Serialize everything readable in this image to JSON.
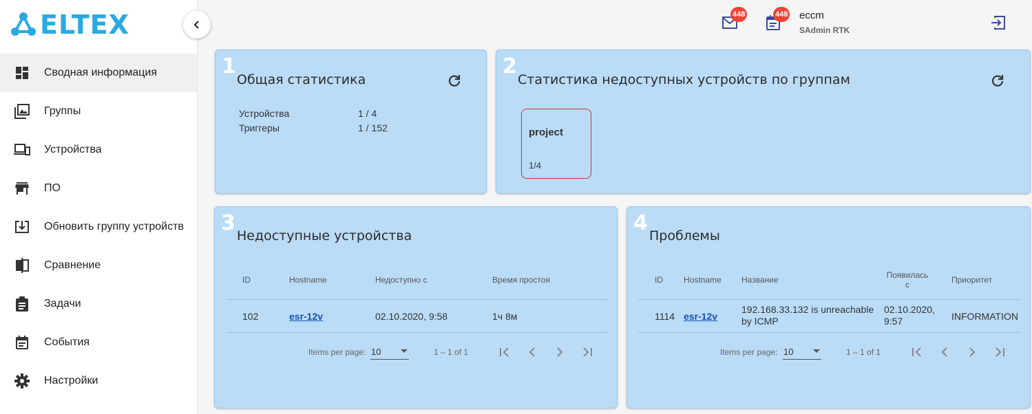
{
  "brand": {
    "logo_text": "ELTEX",
    "color": "#29a9e1"
  },
  "sidebar": {
    "items": [
      {
        "label": "Сводная информация",
        "icon": "dashboard-icon",
        "active": true
      },
      {
        "label": "Группы",
        "icon": "image-library-icon"
      },
      {
        "label": "Устройства",
        "icon": "devices-icon"
      },
      {
        "label": "ПО",
        "icon": "store-icon"
      },
      {
        "label": "Обновить группу устройств",
        "icon": "download-box-icon"
      },
      {
        "label": "Сравнение",
        "icon": "compare-icon"
      },
      {
        "label": "Задачи",
        "icon": "clipboard-icon"
      },
      {
        "label": "События",
        "icon": "event-note-icon"
      },
      {
        "label": "Настройки",
        "icon": "gear-icon"
      }
    ]
  },
  "header": {
    "mail_badge": "448",
    "notes_badge": "448",
    "user_name": "eccm",
    "user_role": "SAdmin RTK"
  },
  "cards": {
    "general": {
      "num": "1",
      "title": "Общая статистика",
      "rows": [
        {
          "label": "Устройства",
          "value": "1 / 4"
        },
        {
          "label": "Триггеры",
          "value": "1 / 152"
        }
      ]
    },
    "groups": {
      "num": "2",
      "title": "Статистика недоступных устройств по группам",
      "tiles": [
        {
          "name": "project",
          "count": "1/4"
        }
      ]
    },
    "unavailable": {
      "num": "3",
      "title": "Недоступные устройства",
      "columns": [
        "ID",
        "Hostname",
        "Недоступно с",
        "Время простоя"
      ],
      "rows": [
        {
          "id": "102",
          "hostname": "esr-12v",
          "since": "02.10.2020, 9:58",
          "downtime": "1ч 8м"
        }
      ],
      "pagination": {
        "items_label": "Items per page:",
        "per_page": "10",
        "range": "1 – 1 of 1"
      }
    },
    "problems": {
      "num": "4",
      "title": "Проблемы",
      "columns": [
        "ID",
        "Hostname",
        "Название",
        "Появилась с",
        "Приоритет"
      ],
      "rows": [
        {
          "id": "1114",
          "hostname": "esr-12v",
          "name": "192.168.33.132 is unreachable by ICMP",
          "appeared": "02.10.2020, 9:57",
          "priority": "INFORMATION"
        }
      ],
      "pagination": {
        "items_label": "Items per page:",
        "per_page": "10",
        "range": "1 – 1 of 1"
      }
    }
  }
}
